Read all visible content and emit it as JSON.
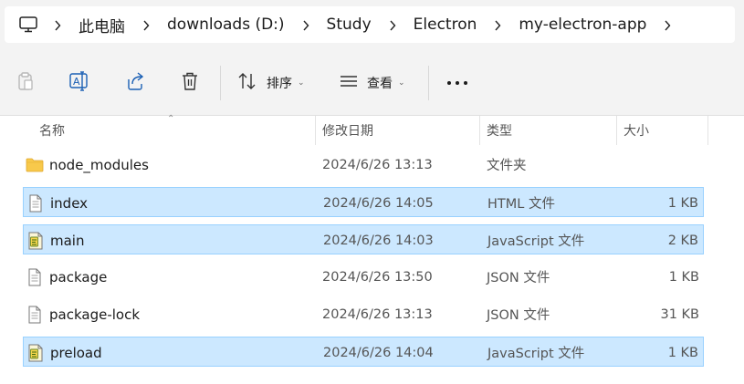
{
  "breadcrumbs": [
    "此电脑",
    "downloads (D:)",
    "Study",
    "Electron",
    "my-electron-app"
  ],
  "toolbar": {
    "sort_label": "排序",
    "view_label": "查看"
  },
  "columns": {
    "name": "名称",
    "date": "修改日期",
    "type": "类型",
    "size": "大小"
  },
  "files": [
    {
      "name": "node_modules",
      "date": "2024/6/26 13:13",
      "type": "文件夹",
      "size": "",
      "icon": "folder-icon",
      "selected": false
    },
    {
      "name": "index",
      "date": "2024/6/26 14:05",
      "type": "HTML 文件",
      "size": "1 KB",
      "icon": "document-icon",
      "selected": true
    },
    {
      "name": "main",
      "date": "2024/6/26 14:03",
      "type": "JavaScript 文件",
      "size": "2 KB",
      "icon": "script-icon",
      "selected": true
    },
    {
      "name": "package",
      "date": "2024/6/26 13:50",
      "type": "JSON 文件",
      "size": "1 KB",
      "icon": "document-icon",
      "selected": false
    },
    {
      "name": "package-lock",
      "date": "2024/6/26 13:13",
      "type": "JSON 文件",
      "size": "31 KB",
      "icon": "document-icon",
      "selected": false
    },
    {
      "name": "preload",
      "date": "2024/6/26 14:04",
      "type": "JavaScript 文件",
      "size": "1 KB",
      "icon": "script-icon",
      "selected": true
    }
  ],
  "colors": {
    "selection_bg": "#cce8ff",
    "selection_border": "#99d1ff",
    "folder": "#f8c94b",
    "chrome_bg": "#f3f3f3"
  }
}
